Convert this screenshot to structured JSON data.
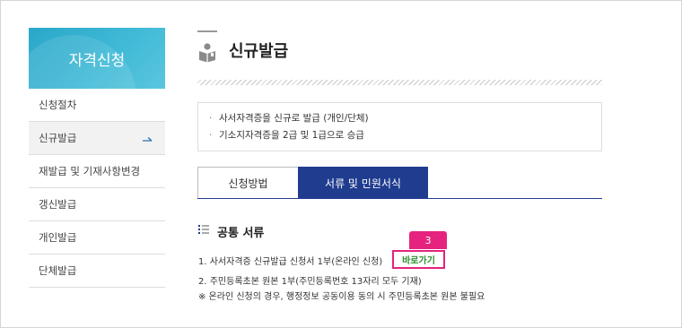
{
  "sidebar": {
    "heading": "자격신청",
    "items": [
      {
        "label": "신청절차"
      },
      {
        "label": "신규발급",
        "active": true
      },
      {
        "label": "재발급 및 기재사항변경"
      },
      {
        "label": "갱신발급"
      },
      {
        "label": "개인발급"
      },
      {
        "label": "단체발급"
      }
    ]
  },
  "main": {
    "title": "신규발급",
    "title_icon": "reading-person-icon",
    "info": [
      "사서자격증을 신규로 발급 (개인/단체)",
      "기소지자격증을 2급 및 1급으로 승급"
    ],
    "tabs": [
      {
        "label": "신청방법",
        "active": false
      },
      {
        "label": "서류 및 민원서식",
        "active": true
      }
    ],
    "section": {
      "title": "공통 서류",
      "icon": "list-icon",
      "lines": [
        "1. 사서자격증 신규발급 신청서 1부(온라인 신청)",
        "2. 주민등록초본 원본 1부(주민등록번호 13자리 모두 기재)",
        "※ 온라인 신청의 경우, 행정정보 공동이용 동의 시 주민등록초본 원본 불필요"
      ],
      "go_button": "바로가기",
      "badge": "3"
    }
  },
  "colors": {
    "sidebar_head": "#3fb9d6",
    "tab_active": "#1f3c8f",
    "highlight": "#e5237f",
    "go_text": "#2f8f2f"
  }
}
